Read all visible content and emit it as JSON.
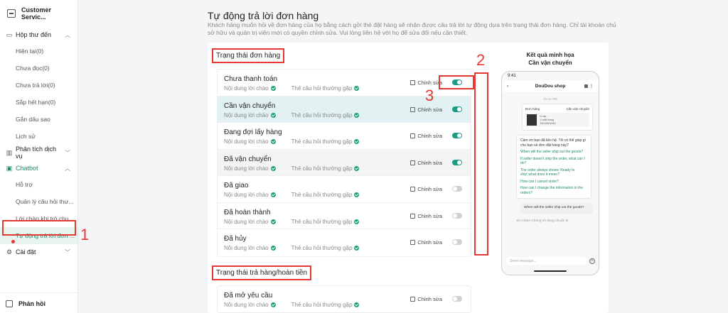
{
  "sidebar": {
    "brand": "Customer Servic...",
    "groups": [
      {
        "label": "Hộp thư đến",
        "items": [
          "Hiện tại(0)",
          "Chưa đọc(0)",
          "Chưa trả lời(0)",
          "Sắp hết hạn(0)",
          "Gắn dấu sao",
          "Lịch sử"
        ]
      },
      {
        "label": "Phân tích dịch vụ"
      },
      {
        "label": "Chatbot",
        "items": [
          "Hỗ trợ",
          "Quản lý câu hỏi thư...",
          "Lời chào khi trò chu...",
          "Tự động trả lời đơn ..."
        ]
      },
      {
        "label": "Cài đặt"
      }
    ],
    "feedback": "Phản hồi"
  },
  "annotations": {
    "n1": "1",
    "n2": "2",
    "n3": "3"
  },
  "page": {
    "title": "Tự động trả lời đơn hàng",
    "description": "Khách hàng muốn hỏi về đơn hàng của họ bằng cách gởi thẻ đặt hàng sẽ nhận được câu trả lời tự động dựa trên trạng thái đơn hàng. Chỉ tài khoản chủ sở hữu và quản trị viên mới có quyền chỉnh sửa. Vui lòng liên hệ với họ để sửa đổi nếu cần thiết."
  },
  "section1": {
    "title": "Trạng thái đơn hàng",
    "sub_greeting": "Nội dung lời chào",
    "sub_faq": "Thẻ câu hỏi thường gặp",
    "edit_label": "Chỉnh sửa",
    "rows": [
      {
        "title": "Chưa thanh toán",
        "on": true
      },
      {
        "title": "Cần vận chuyển",
        "on": true
      },
      {
        "title": "Đang đợi lấy hàng",
        "on": true
      },
      {
        "title": "Đã vận chuyển",
        "on": true
      },
      {
        "title": "Đã giao",
        "on": false
      },
      {
        "title": "Đã hoàn thành",
        "on": false
      },
      {
        "title": "Đã hủy",
        "on": false
      }
    ]
  },
  "section2": {
    "title": "Trạng thái trả hàng/hoàn tiền",
    "rows": [
      {
        "title": "Đã mở yêu cầu",
        "on": false
      }
    ]
  },
  "preview": {
    "title1": "Kết quả minh họa",
    "title2": "Cần vận chuyển",
    "status_time": "9:41",
    "shop": "DouDou shop",
    "time": "10:31 PM",
    "order_label": "Đơn hàng",
    "order_status": "Cần vận chuyển",
    "order_item": "Ví dụ",
    "order_qty": "1 mặt hàng",
    "order_price": "100.000VND",
    "greeting": "Cảm ơn bạn đã liên hệ. Tôi có thể giúp gì cho bạn về đơn đặt hàng này?",
    "questions": [
      "When will the seller ship out the goods?",
      "If seller doesn't ship the order, what can I do?",
      "The order always shows 'Ready to ship',what does it mean?",
      "How can I cancel order?",
      "How can I change the information in the orders?"
    ],
    "reply": "When will the seller ship out the goods?",
    "partial": "Xin chào! Chúng tôi đang chuẩn bị",
    "input_placeholder": "Send message..."
  }
}
